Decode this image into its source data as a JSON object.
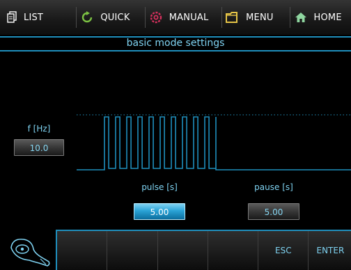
{
  "menu": {
    "items": [
      {
        "label": "LIST",
        "icon": "list-icon"
      },
      {
        "label": "QUICK",
        "icon": "quick-icon"
      },
      {
        "label": "MANUAL",
        "icon": "manual-icon"
      },
      {
        "label": "MENU",
        "icon": "menu-icon"
      },
      {
        "label": "HOME",
        "icon": "home-icon"
      }
    ]
  },
  "title": "basic mode settings",
  "frequency": {
    "label": "f [Hz]",
    "value": "10.0"
  },
  "pulse": {
    "label": "pulse [s]",
    "value": "5.00",
    "selected": true
  },
  "pause": {
    "label": "pause [s]",
    "value": "5.00"
  },
  "waveform": {
    "pulse_count": 10,
    "pulse_seconds": 5.0,
    "pause_seconds": 5.0
  },
  "softkeys": {
    "esc": "ESC",
    "enter": "ENTER"
  },
  "colors": {
    "accent": "#1f8fbd",
    "text": "#7fd3f2",
    "active_field": "#2aa3d6",
    "quick_icon": "#7cc243",
    "manual_icon": "#d5305d",
    "menu_icon": "#e6c547",
    "home_icon": "#8fd6a0"
  }
}
